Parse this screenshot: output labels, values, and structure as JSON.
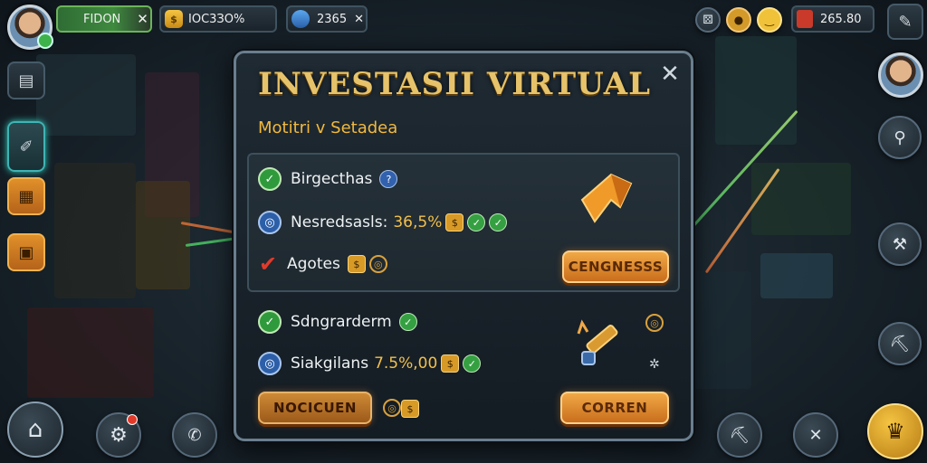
{
  "hud": {
    "pill1": "FIDON",
    "pill2": "IOC3ЗO%",
    "pill3": "2365",
    "pill4": "265.80",
    "icons": [
      "avatar",
      "green-check-cross",
      "coin",
      "gem",
      "dice-icon",
      "coin-icon",
      "emote-icon",
      "ledger-icon",
      "tools-icon"
    ]
  },
  "dialog": {
    "title": "INVESTASII VIRTUAL",
    "subtitle": "Motitri v Setadea",
    "close": "✕",
    "section1": {
      "rows": [
        {
          "label": "Birgecthas",
          "status": "green-check"
        },
        {
          "label": "Nesredsasls:",
          "value": "36,5%",
          "status": "blue-target"
        },
        {
          "label": "Agotes",
          "status": "red-check"
        }
      ],
      "button": "CENGNESSS"
    },
    "section2": {
      "rows": [
        {
          "label": "Sdngrarderm",
          "status": "green-check"
        },
        {
          "label": "Siakgilans",
          "value": "7.5%,00",
          "status": "blue-target"
        }
      ],
      "left_button": "NOCICUEN",
      "right_button": "CORREN"
    }
  },
  "colors": {
    "gold": "#e6c36a",
    "accent_orange": "#f1a846",
    "panel": "#1f2a33"
  }
}
